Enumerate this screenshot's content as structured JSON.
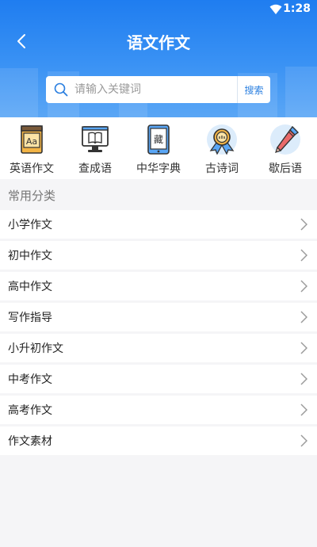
{
  "status_bar": {
    "time": "1:28"
  },
  "header": {
    "title": "语文作文",
    "back_icon": "chevron-left-icon"
  },
  "search": {
    "placeholder": "请输入关键词",
    "button_label": "搜索"
  },
  "shortcuts": [
    {
      "label": "英语作文",
      "icon": "english-book-icon"
    },
    {
      "label": "查成语",
      "icon": "idiom-monitor-icon"
    },
    {
      "label": "中华字典",
      "icon": "dictionary-tablet-icon"
    },
    {
      "label": "古诗词",
      "icon": "poetry-medal-icon"
    },
    {
      "label": "歇后语",
      "icon": "pencil-icon"
    }
  ],
  "section": {
    "title": "常用分类"
  },
  "categories": [
    {
      "label": "小学作文"
    },
    {
      "label": "初中作文"
    },
    {
      "label": "高中作文"
    },
    {
      "label": "写作指导"
    },
    {
      "label": "小升初作文"
    },
    {
      "label": "中考作文"
    },
    {
      "label": "高考作文"
    },
    {
      "label": "作文素材"
    }
  ],
  "colors": {
    "brand_blue": "#1f7df0",
    "accent_orange": "#e98b2a",
    "background": "#f5f5f7"
  }
}
